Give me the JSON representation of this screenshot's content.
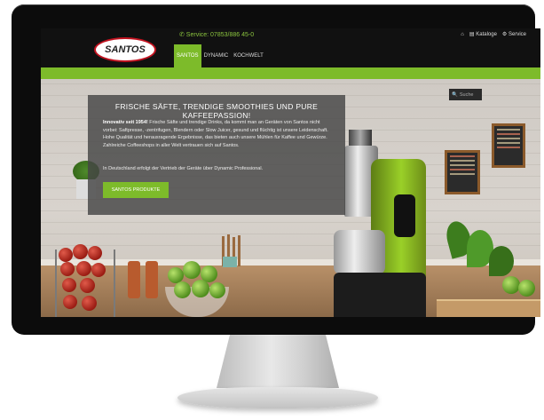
{
  "header": {
    "logo_text": "SANTOS",
    "phone": "✆ Service: 07853/886 45-0",
    "top_links": [
      {
        "icon": "home-icon",
        "label": ""
      },
      {
        "icon": "book-icon",
        "label": "Kataloge"
      },
      {
        "icon": "gear-icon",
        "label": "Service"
      }
    ],
    "nav": [
      {
        "label": "SANTOS",
        "active": true
      },
      {
        "label": "DYNAMIC",
        "active": false
      },
      {
        "label": "KOCHWELT",
        "active": false
      }
    ]
  },
  "green_bar": {
    "items": [
      "",
      "",
      "",
      "",
      "",
      "",
      "",
      ""
    ]
  },
  "hero": {
    "title": "FRISCHE SÄFTE, TRENDIGE SMOOTHIES UND PURE KAFFEEPASSION!",
    "text_bold": "Innovativ seit 1954!",
    "text": " Frische Säfte und trendige Drinks, da kommt man an Geräten von Santos nicht vorbei: Saftpresse, -zentrifugen, Blendern oder Slow Juicer, gesund und flüchtig ist unsere Leidenschaft. Hohe Qualität und herausragende Ergebnisse, das bieten auch unsere Mühlen für Kaffee und Gewürze. Zahlreiche Coffeeshops in aller Welt vertrauen sich auf Santos.",
    "text2": "In Deutschland erfolgt der Vertrieb der Geräte über Dynamic Professional.",
    "cta": "SANTOS PRODUKTE",
    "search_placeholder": "Suche"
  },
  "colors": {
    "accent": "#7dbb2a",
    "dark": "#111111"
  }
}
